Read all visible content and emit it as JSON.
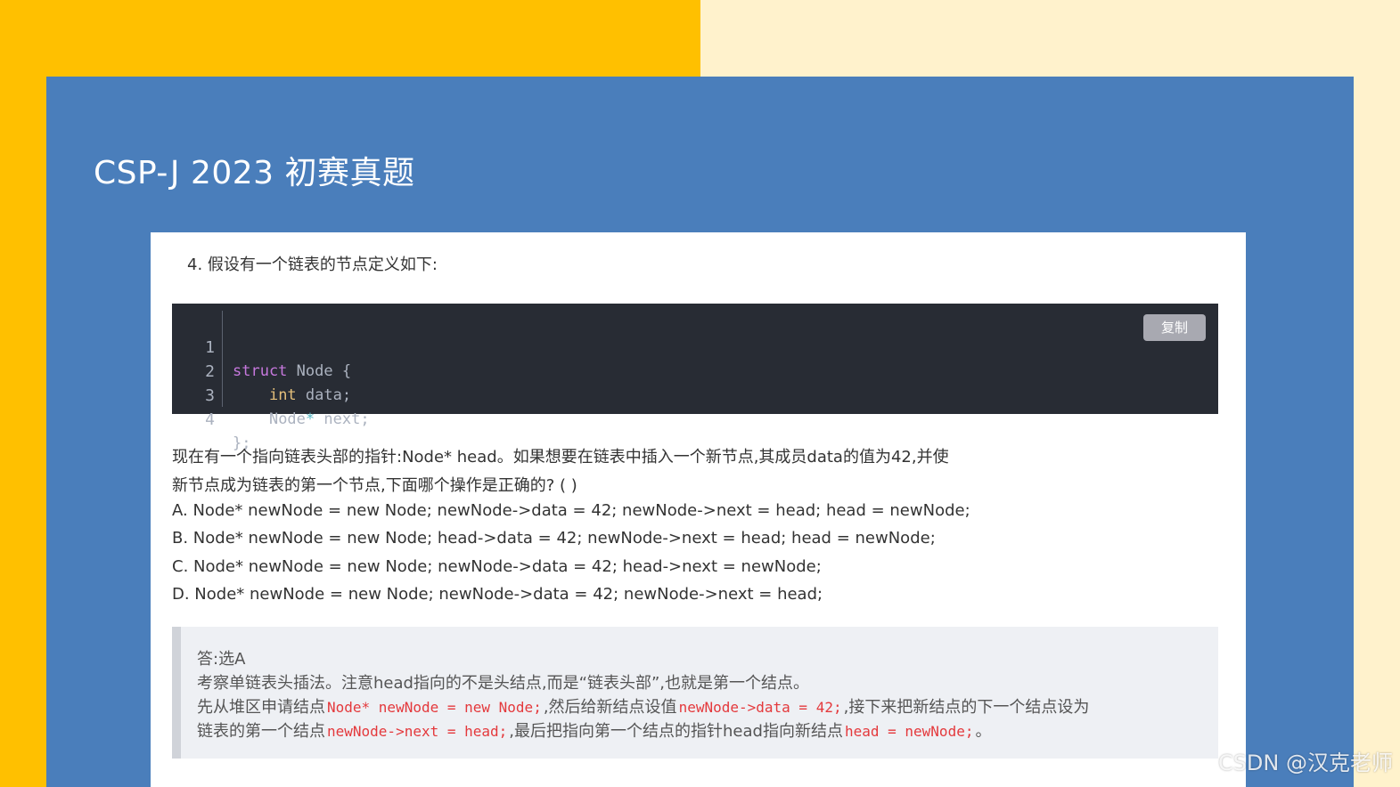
{
  "slide": {
    "title": "CSP-J 2023  初赛真题"
  },
  "question": {
    "intro": "4. 假设有一个链表的节点定义如下:",
    "code": {
      "copy_label": "复制",
      "line_numbers": [
        "1",
        "2",
        "3",
        "4"
      ],
      "lines": [
        {
          "kw": "struct",
          "rest": " Node {"
        },
        {
          "indent": "    ",
          "kw": "int",
          "rest": " data;"
        },
        {
          "indent": "    ",
          "type": "Node",
          "op": "*",
          "rest": " next;"
        },
        {
          "rest": "};"
        }
      ]
    },
    "stem_line1": "现在有一个指向链表头部的指针:Node* head。如果想要在链表中插入一个新节点,其成员data的值为42,并使",
    "stem_line2": "新节点成为链表的第一个节点,下面哪个操作是正确的? ( )",
    "options": [
      "A. Node* newNode = new Node; newNode->data = 42; newNode->next = head; head = newNode;",
      "B. Node* newNode = new Node; head->data = 42; newNode->next = head; head = newNode;",
      "C. Node* newNode = new Node; newNode->data = 42; head->next = newNode;",
      "D. Node* newNode = new Node; newNode->data = 42; newNode->next = head;"
    ]
  },
  "answer": {
    "line1": "答:选A",
    "line2": "考察单链表头插法。注意head指向的不是头结点,而是“链表头部”,也就是第一个结点。",
    "line3_a": "先从堆区申请结点",
    "line3_code1": "Node* newNode = new Node;",
    "line3_b": ",然后给新结点设值",
    "line3_code2": "newNode->data = 42;",
    "line3_c": ",接下来把新结点的下一个结点设为",
    "line4_a": "链表的第一个结点",
    "line4_code1": "newNode->next = head;",
    "line4_b": ",最后把指向第一个结点的指针head指向新结点",
    "line4_code2": "head = newNode;",
    "line4_c": "。"
  },
  "watermark": "CSDN @汉克老师"
}
